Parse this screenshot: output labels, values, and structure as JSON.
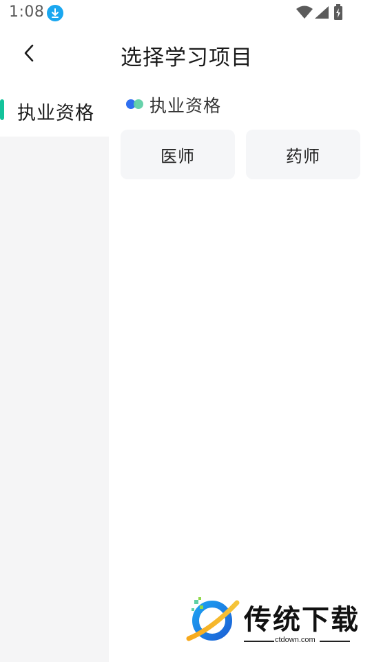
{
  "status_bar": {
    "time": "1:08",
    "icons": [
      "download-icon",
      "wifi-icon",
      "signal-icon",
      "battery-icon"
    ]
  },
  "header": {
    "back_icon": "chevron-left-icon",
    "title": "选择学习项目"
  },
  "sidebar": {
    "items": [
      {
        "label": "执业资格",
        "selected": true
      }
    ],
    "indicator_color": "#13c39b"
  },
  "main": {
    "section_title": "执业资格",
    "options": [
      {
        "label": "医师"
      },
      {
        "label": "药师"
      }
    ]
  },
  "watermark": {
    "brand": "传统下载",
    "url": "ctdown.com"
  },
  "colors": {
    "accent": "#13c39b",
    "dot_blue": "#2f6ff0",
    "dot_green": "#5fd0a6",
    "card_bg": "#f5f6f8",
    "sidebar_bg": "#f5f5f6"
  }
}
